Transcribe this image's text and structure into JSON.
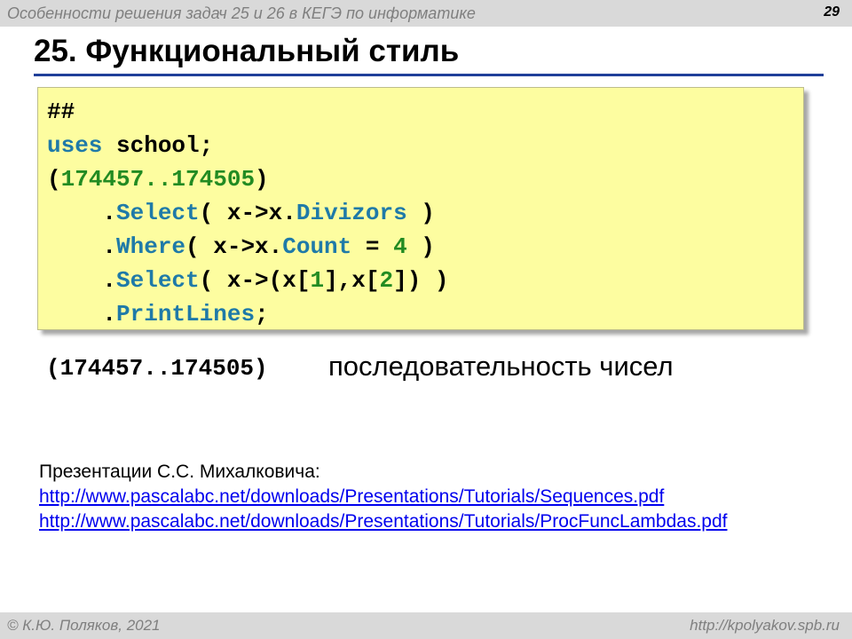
{
  "header": {
    "subject": "Особенности решения задач 25 и 26 в КЕГЭ по информатике",
    "page_number": "29"
  },
  "slide": {
    "title": "25. Функциональный стиль"
  },
  "code": {
    "l1": "##",
    "l2_kw": "uses",
    "l2_rest": " school;",
    "l3_open": "(",
    "l3_range": "174457..174505",
    "l3_close": ")",
    "l4_dot": "    .",
    "l4_kw": "Select",
    "l4_mid": "( x->x.",
    "l4_kw2": "Divizors",
    "l4_end": " )",
    "l5_dot": "    .",
    "l5_kw": "Where",
    "l5_mid": "( x->x.",
    "l5_kw2": "Count",
    "l5_eq": " = ",
    "l5_num": "4",
    "l5_end": " )",
    "l6_dot": "    .",
    "l6_kw": "Select",
    "l6_a": "( x->(x[",
    "l6_n1": "1",
    "l6_b": "],x[",
    "l6_n2": "2",
    "l6_c": "]) )",
    "l7_dot": "    .",
    "l7_kw": "PrintLines",
    "l7_end": ";"
  },
  "explanation": {
    "code": "(174457..174505)",
    "text": "последовательность чисел"
  },
  "references": {
    "label": "Презентации С.С. Михалковича:",
    "links": [
      "http://www.pascalabc.net/downloads/Presentations/Tutorials/Sequences.pdf",
      "http://www.pascalabc.net/downloads/Presentations/Tutorials/ProcFuncLambdas.pdf"
    ]
  },
  "footer": {
    "author": "© К.Ю. Поляков, 2021",
    "site": "http://kpolyakov.spb.ru"
  },
  "colors": {
    "code_bg": "#fdfda0",
    "keyword": "#1f7aa8",
    "number": "#228b22",
    "rule": "#1f3f99",
    "link": "#0000ee"
  }
}
